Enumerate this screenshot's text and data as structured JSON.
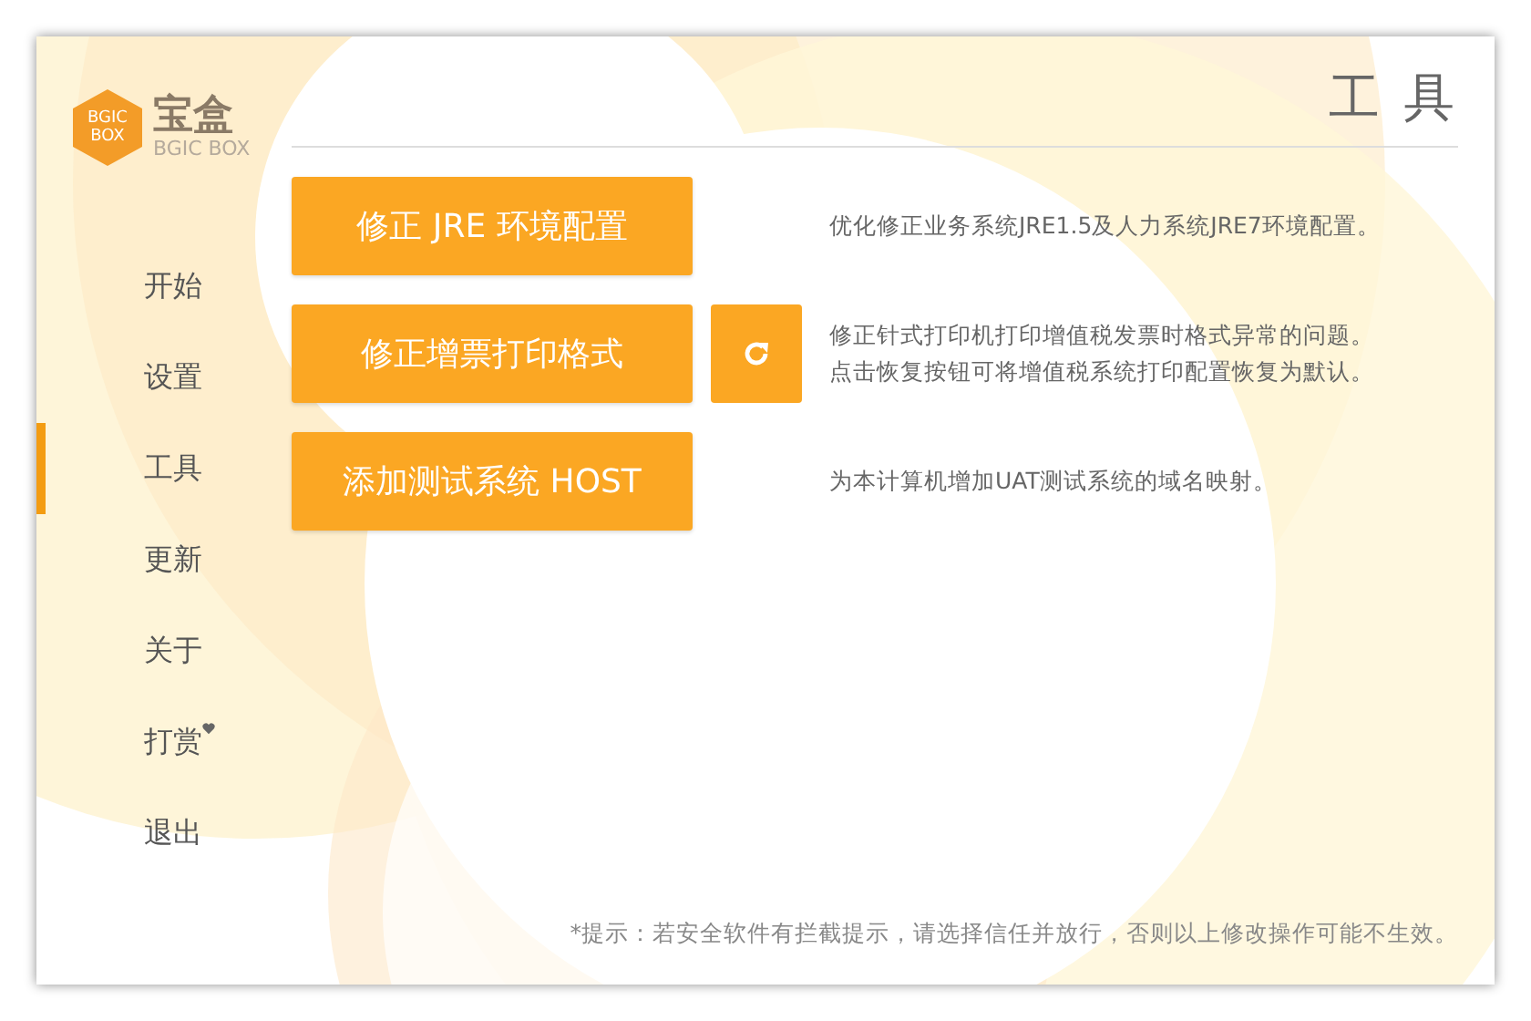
{
  "logo": {
    "badge_lines": [
      "BGIC",
      "BOX"
    ],
    "name": "宝盒",
    "subtitle": "BGIC BOX"
  },
  "nav": [
    {
      "label": "开始",
      "selected": false,
      "heart": false
    },
    {
      "label": "设置",
      "selected": false,
      "heart": false
    },
    {
      "label": "工具",
      "selected": true,
      "heart": false
    },
    {
      "label": "更新",
      "selected": false,
      "heart": false
    },
    {
      "label": "关于",
      "selected": false,
      "heart": false
    },
    {
      "label": "打赏",
      "selected": false,
      "heart": true
    },
    {
      "label": "退出",
      "selected": false,
      "heart": false
    }
  ],
  "title": "工 具",
  "tools": [
    {
      "label": "修正 JRE 环境配置",
      "reset_button": false,
      "description": [
        "优化修正业务系统JRE1.5及人力系统JRE7环境配置。"
      ]
    },
    {
      "label": "修正增票打印格式",
      "reset_button": true,
      "description": [
        "修正针式打印机打印增值税发票时格式异常的问题。",
        "点击恢复按钮可将增值税系统打印配置恢复为默认。"
      ]
    },
    {
      "label": "添加测试系统 HOST",
      "reset_button": false,
      "description": [
        "为本计算机增加UAT测试系统的域名映射。"
      ]
    }
  ],
  "hint": "*提示：若安全软件有拦截提示，请选择信任并放行，否则以上修改操作可能不生效。"
}
